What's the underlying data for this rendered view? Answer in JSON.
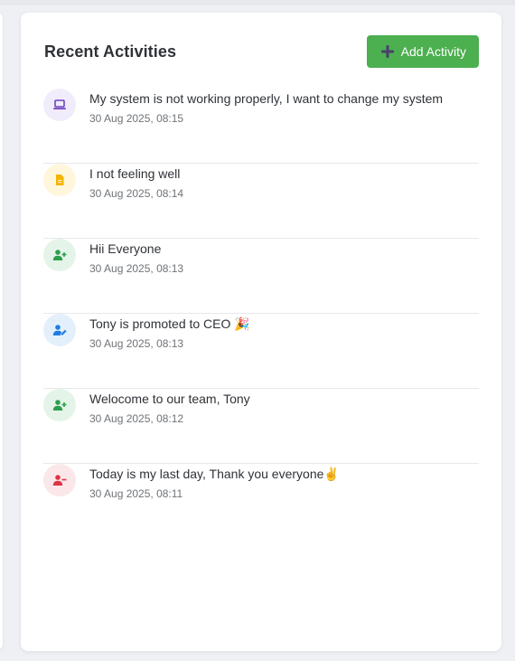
{
  "header": {
    "title": "Recent Activities",
    "add_button_label": "Add Activity"
  },
  "colors": {
    "accent_green": "#4caf50",
    "purple": "#6f42c1",
    "yellow": "#f4b400",
    "green": "#2e9e4d",
    "blue": "#1e7ee4",
    "red": "#dc3545"
  },
  "activities": [
    {
      "icon": "laptop-icon",
      "message": "My system is not working properly, I want to change my system",
      "time": "30 Aug 2025, 08:15"
    },
    {
      "icon": "document-icon",
      "message": "I not feeling well",
      "time": "30 Aug 2025, 08:14"
    },
    {
      "icon": "user-add-icon",
      "message": "Hii Everyone",
      "time": "30 Aug 2025, 08:13"
    },
    {
      "icon": "user-edit-icon",
      "message": "Tony is promoted to CEO 🎉",
      "time": "30 Aug 2025, 08:13"
    },
    {
      "icon": "user-add-icon",
      "message": "Welocome to our team, Tony",
      "time": "30 Aug 2025, 08:12"
    },
    {
      "icon": "user-remove-icon",
      "message": "Today is my last day, Thank you everyone✌️",
      "time": "30 Aug 2025, 08:11"
    }
  ]
}
